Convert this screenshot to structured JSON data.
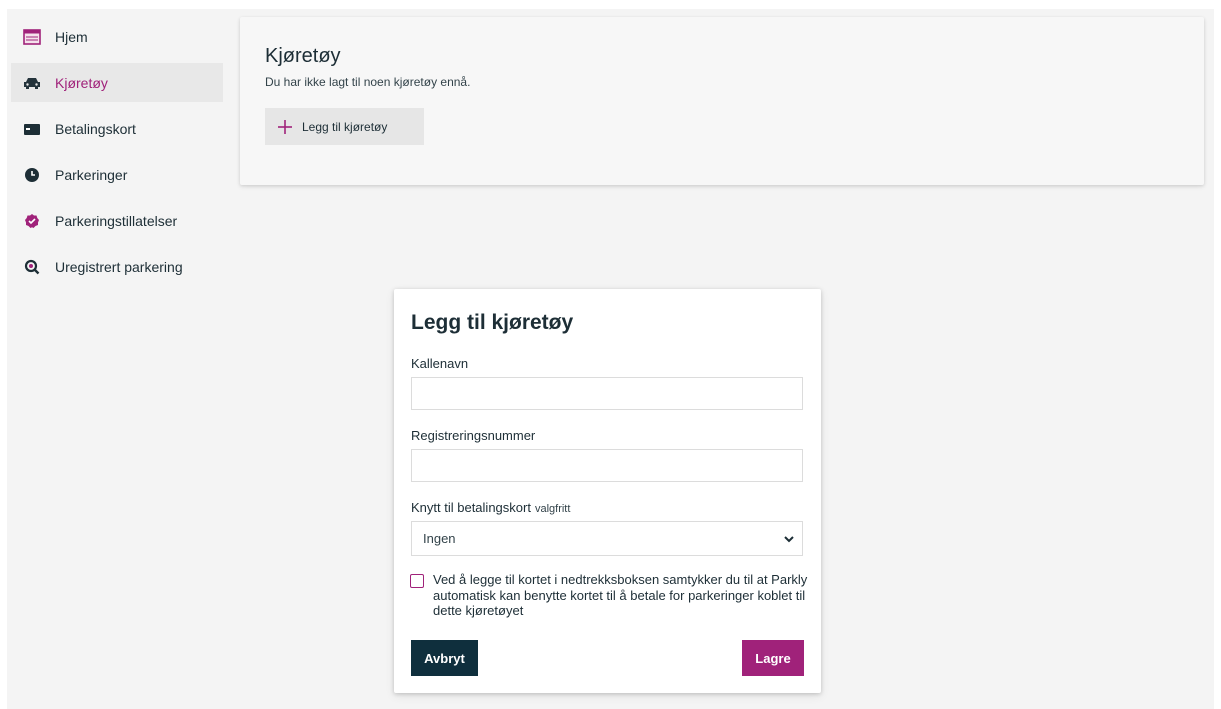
{
  "sidebar": {
    "items": [
      {
        "label": "Hjem",
        "icon": "calendar-icon"
      },
      {
        "label": "Kjøretøy",
        "icon": "car-icon",
        "active": true
      },
      {
        "label": "Betalingskort",
        "icon": "credit-card-icon"
      },
      {
        "label": "Parkeringer",
        "icon": "clock-icon"
      },
      {
        "label": "Parkeringstillatelser",
        "icon": "badge-check-icon"
      },
      {
        "label": "Uregistrert parkering",
        "icon": "search-icon"
      }
    ]
  },
  "panel": {
    "title": "Kjøretøy",
    "subtitle": "Du har ikke lagt til noen kjøretøy ennå.",
    "add_button": "Legg til kjøretøy"
  },
  "modal": {
    "title": "Legg til kjøretøy",
    "nickname_label": "Kallenavn",
    "nickname_value": "",
    "regnr_label": "Registreringsnummer",
    "regnr_value": "",
    "card_label": "Knytt til betalingskort",
    "card_optional": "valgfritt",
    "card_selected": "Ingen",
    "consent_text": "Ved å legge til kortet i nedtrekksboksen samtykker du til at Parkly automatisk kan benytte kortet til å betale for parkeringer koblet til dette kjøretøyet",
    "consent_checked": false,
    "cancel_label": "Avbryt",
    "save_label": "Lagre"
  },
  "colors": {
    "brand": "#a0227a",
    "dark": "#0f2f3d",
    "background": "#f4f4f4"
  }
}
